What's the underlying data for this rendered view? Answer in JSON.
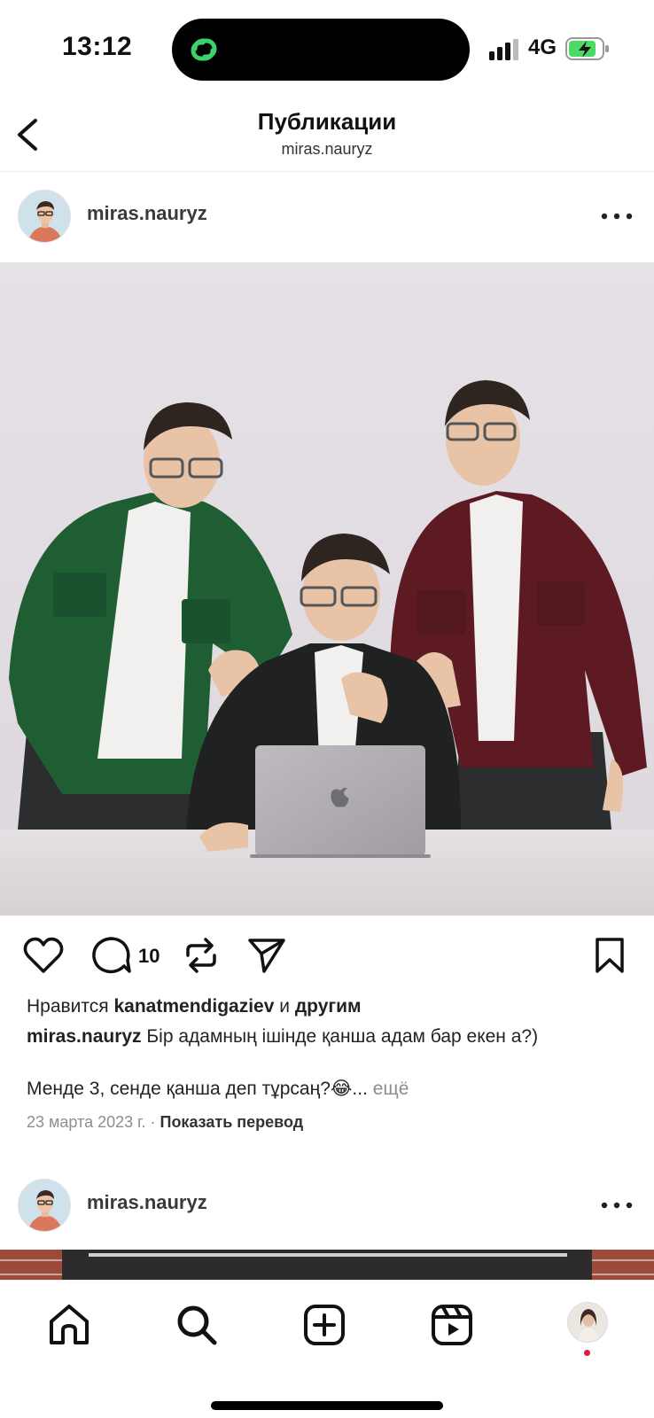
{
  "status_bar": {
    "time": "13:12",
    "network": "4G",
    "signal_icon": "signal-bars-icon",
    "battery_icon": "battery-charging-icon",
    "battery_color": "#4cd964"
  },
  "header": {
    "title": "Публикации",
    "subtitle": "miras.nauryz",
    "back_icon": "chevron-left-icon"
  },
  "posts": [
    {
      "username": "miras.nauryz",
      "more_icon": "more-horizontal-icon",
      "comment_count": "10",
      "likes": {
        "prefix": "Нравится ",
        "user": "kanatmendigaziev",
        "middle": " и ",
        "others": "другим"
      },
      "caption": {
        "author": "miras.nauryz",
        "text": " Бір адамның ішінде қанша адам бар екен а?)"
      },
      "caption_line2": {
        "text": "Менде 3, сенде қанша деп тұрсаң?😂...",
        "more": " ещё"
      },
      "date": "23 марта 2023 г.",
      "separator": " · ",
      "translate": "Показать перевод"
    },
    {
      "username": "miras.nauryz",
      "more_icon": "more-horizontal-icon"
    }
  ],
  "bottom_nav": {
    "items": [
      "home-icon",
      "search-icon",
      "new-post-icon",
      "reels-icon",
      "profile-avatar"
    ]
  },
  "colors": {
    "jacket_green": "#1f5d33",
    "jacket_burgundy": "#5e1a22",
    "jacket_black": "#1f2220",
    "notification_dot": "#e21b3c"
  }
}
